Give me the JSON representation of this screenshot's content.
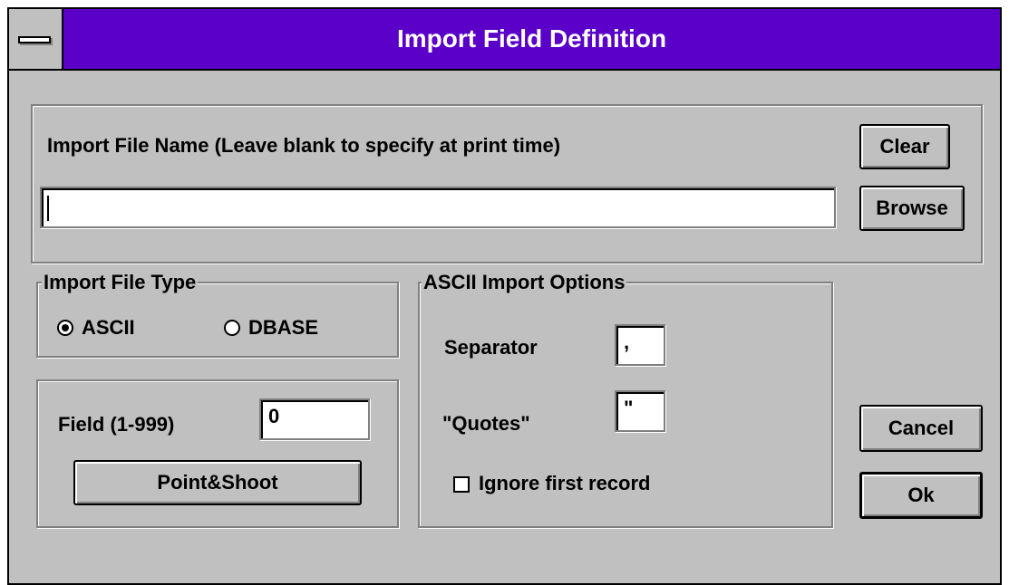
{
  "window": {
    "title": "Import Field Definition"
  },
  "file_section": {
    "label": "Import File Name (Leave blank to specify at print time)",
    "file_name_value": "",
    "clear_label": "Clear",
    "browse_label": "Browse"
  },
  "file_type": {
    "legend": "Import File Type",
    "options": [
      "ASCII",
      "DBASE"
    ],
    "selected": "ASCII"
  },
  "field_section": {
    "label": "Field (1-999)",
    "value": "0",
    "point_shoot_label": "Point&Shoot"
  },
  "ascii_options": {
    "legend": "ASCII Import Options",
    "separator_label": "Separator",
    "separator_value": ",",
    "quotes_label": "\"Quotes\"",
    "quotes_value": "\"",
    "ignore_first_label": "Ignore first record",
    "ignore_first_checked": false
  },
  "buttons": {
    "cancel_label": "Cancel",
    "ok_label": "Ok"
  },
  "colors": {
    "titlebar": "#5a00c8",
    "face": "#c0c0c0"
  }
}
